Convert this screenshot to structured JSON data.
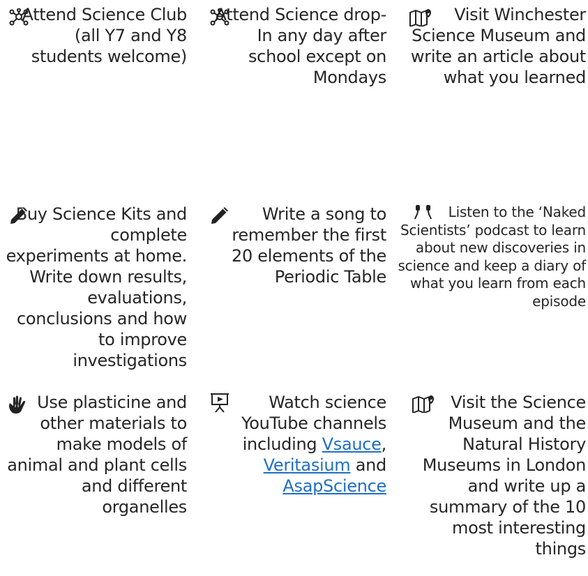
{
  "activities": [
    {
      "icon": "molecule-icon",
      "text": "Attend Science Club (all Y7 and Y8 students welcome)"
    },
    {
      "icon": "molecule-icon",
      "text": "Attend Science drop-In any day after school except on Mondays"
    },
    {
      "icon": "map-pin-icon",
      "text": "Visit Winchester Science Museum and write an article about what you learned"
    },
    {
      "icon": "pencil-icon",
      "text": "Buy Science Kits and complete experiments at home. Write down results, evaluations, conclusions and how to improve investigations"
    },
    {
      "icon": "pencil-icon",
      "text": "Write a song to remember the first 20 elements of the Periodic Table"
    },
    {
      "icon": "earbuds-icon",
      "text": "Listen to the ‘Naked Scientists’ podcast to learn about new discoveries in science and keep a diary of what you learn from each episode"
    },
    {
      "icon": "hand-icon",
      "text": "Use plasticine and other materials to make models of animal and plant cells and different organelles"
    },
    {
      "icon": "presentation-icon",
      "text_before": "Watch science YouTube channels including",
      "links": [
        "Vsauce",
        "Veritasium",
        "AsapScience"
      ],
      "joiner_and": "and"
    },
    {
      "icon": "map-pin-icon",
      "text": "Visit the Science Museum and the Natural History Museums in London and write up a summary of the 10 most interesting things"
    }
  ]
}
